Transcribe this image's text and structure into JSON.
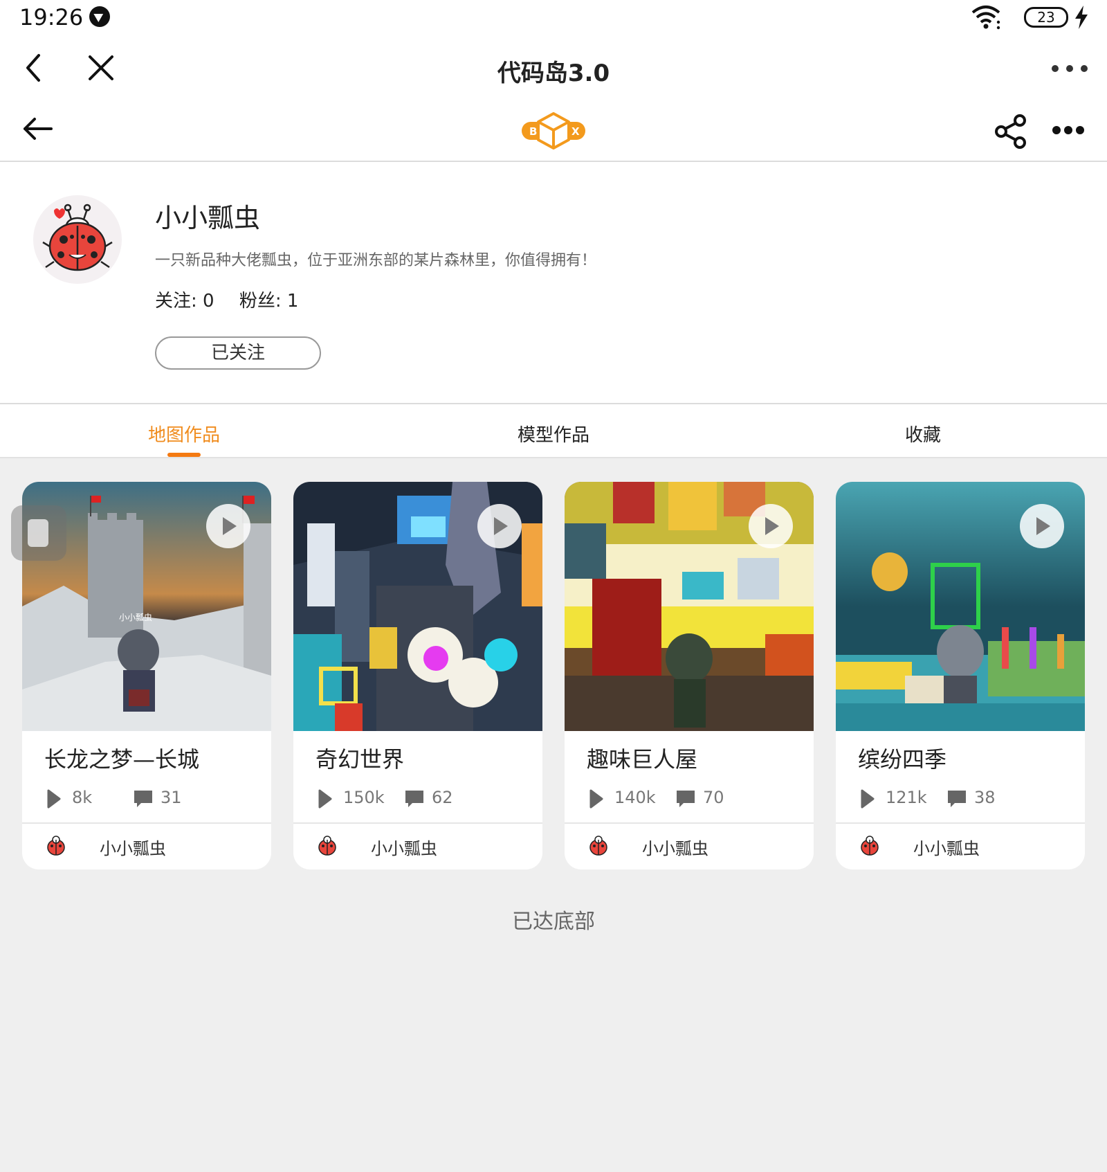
{
  "status_bar": {
    "time": "19:26",
    "battery": "23"
  },
  "title_bar": {
    "title": "代码岛3.0"
  },
  "profile": {
    "name": "小小瓢虫",
    "bio": "一只新品种大佬瓢虫，位于亚洲东部的某片森林里，你值得拥有！",
    "following_label": "关注: 0",
    "followers_label": "粉丝: 1",
    "follow_button": "已关注"
  },
  "tabs": [
    {
      "label": "地图作品",
      "active": true
    },
    {
      "label": "模型作品",
      "active": false
    },
    {
      "label": "收藏",
      "active": false
    }
  ],
  "cards": [
    {
      "title": "长龙之梦—长城",
      "views": "8k",
      "comments": "31",
      "author": "小小瓢虫",
      "thumb_label": "小小瓢虫"
    },
    {
      "title": "奇幻世界",
      "views": "150k",
      "comments": "62",
      "author": "小小瓢虫"
    },
    {
      "title": "趣味巨人屋",
      "views": "140k",
      "comments": "70",
      "author": "小小瓢虫"
    },
    {
      "title": "缤纷四季",
      "views": "121k",
      "comments": "38",
      "author": "小小瓢虫"
    }
  ],
  "footer": "已达底部",
  "colors": {
    "accent": "#f08c1e",
    "background": "#efefef",
    "card": "#ffffff"
  }
}
